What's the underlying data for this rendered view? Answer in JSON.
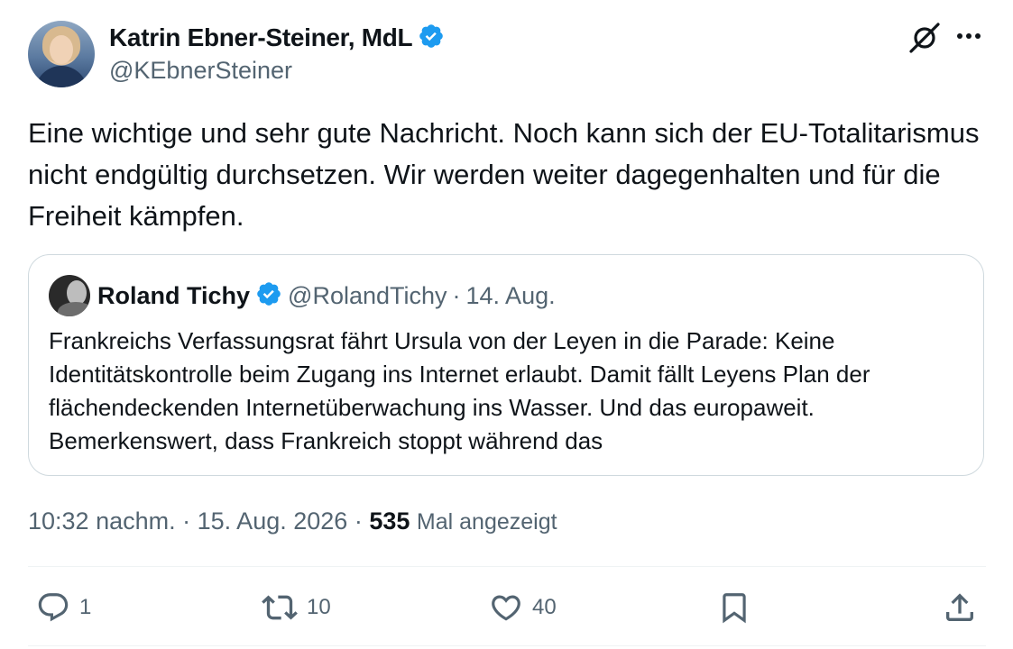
{
  "author": {
    "name": "Katrin Ebner-Steiner, MdL",
    "handle": "@KEbnerSteiner",
    "verified": true
  },
  "tweet": {
    "text": "Eine wichtige und sehr gute Nachricht. Noch kann sich der EU-Totalitarismus nicht endgültig durchsetzen. Wir werden weiter dagegenhalten und für die Freiheit kämpfen."
  },
  "quoted_tweet": {
    "name": "Roland Tichy",
    "verified": true,
    "handle": "@RolandTichy",
    "separator": "·",
    "date": "14. Aug.",
    "text": "Frankreichs Verfassungsrat fährt Ursula von der Leyen in die Parade: Keine Identitätskontrolle beim Zugang ins Internet erlaubt. Damit fällt Leyens Plan der flächendeckenden Internetüberwachung ins Wasser. Und das europaweit. Bemerkenswert, dass Frankreich stoppt während das"
  },
  "meta": {
    "time": "10:32 nachm.",
    "separator": "·",
    "date": "15. Aug. 2026",
    "views_count": "535",
    "views_label": "Mal angezeigt"
  },
  "actions": {
    "replies": "1",
    "reposts": "10",
    "likes": "40"
  },
  "colors": {
    "verified_blue": "#1d9bf0",
    "secondary_text": "#536471",
    "primary_text": "#0f1419",
    "border": "#cfd9de"
  },
  "icons": [
    "verified-badge-icon",
    "grok-icon",
    "more-icon",
    "reply-icon",
    "repost-icon",
    "like-icon",
    "bookmark-icon",
    "share-icon"
  ]
}
